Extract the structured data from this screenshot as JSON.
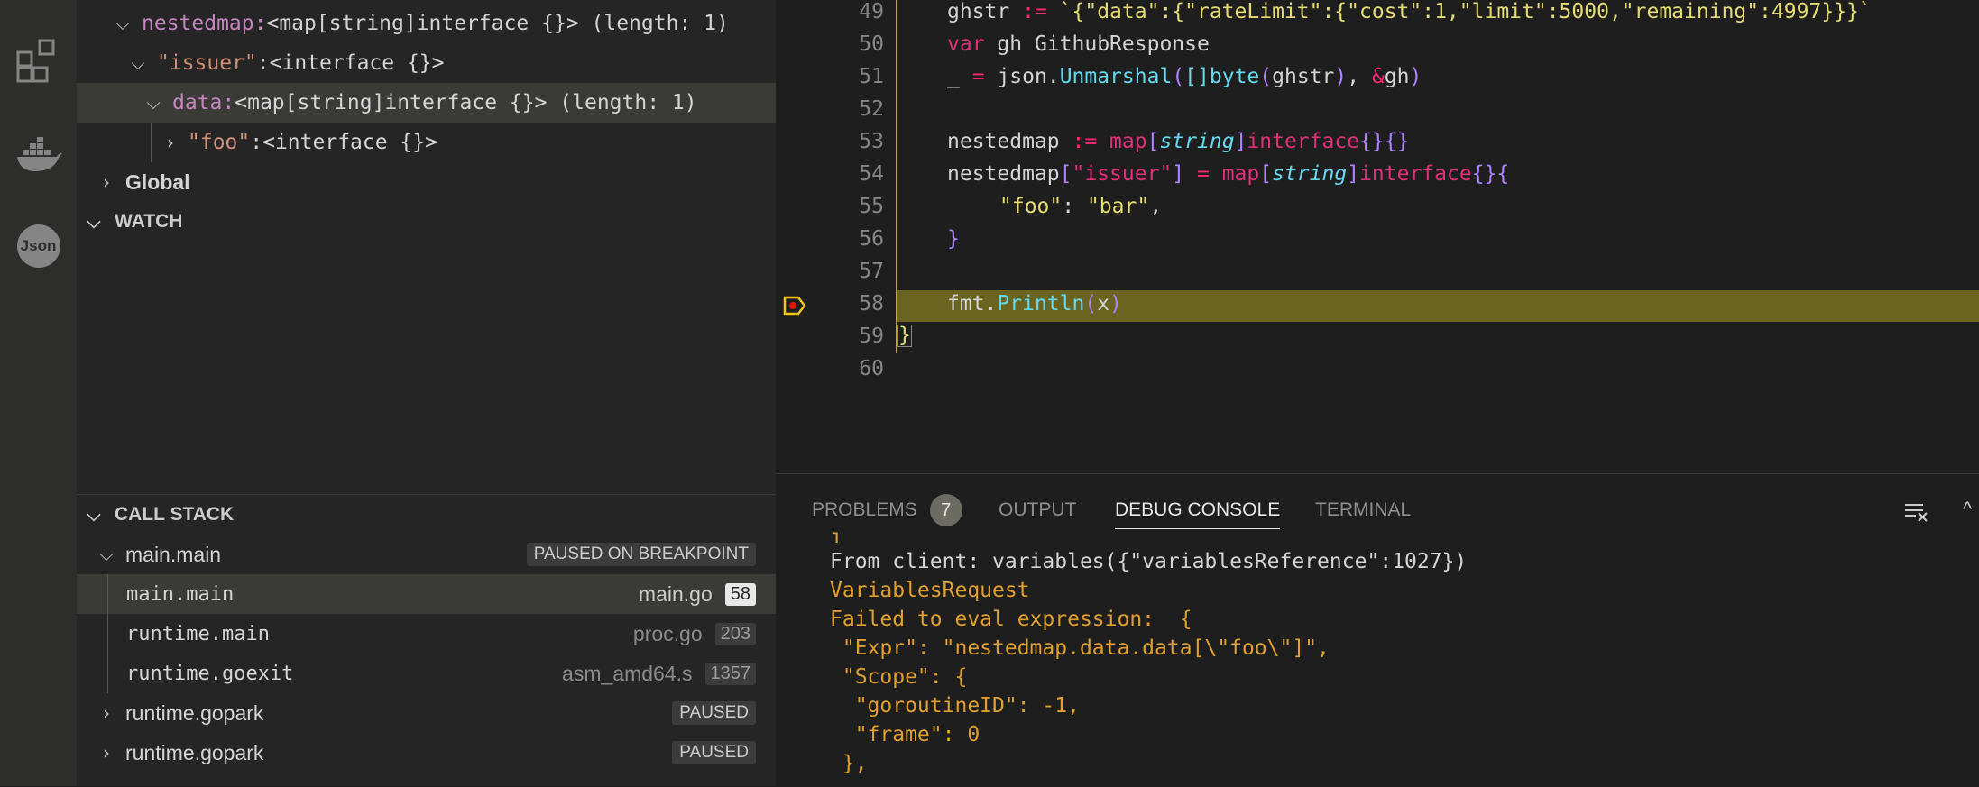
{
  "activity_bar": {
    "icons": [
      "extensions-icon",
      "docker-icon",
      "json-icon"
    ],
    "json_icon_label": "Json"
  },
  "variables": {
    "rows": [
      {
        "key": "nestedmap",
        "sep": ": ",
        "value": "<map[string]interface {}> (length: 1)"
      },
      {
        "key": "\"issuer\"",
        "sep": ": ",
        "value": "<interface {}>"
      },
      {
        "key": "data",
        "sep": ": ",
        "value": "<map[string]interface {}> (length: 1)"
      },
      {
        "key": "\"foo\"",
        "sep": ": ",
        "value": "<interface {}>"
      }
    ],
    "global_label": "Global"
  },
  "watch": {
    "header": "WATCH"
  },
  "call_stack": {
    "header": "CALL STACK",
    "thread_main": {
      "label": "main.main",
      "status": "PAUSED ON BREAKPOINT"
    },
    "frames": [
      {
        "name": "main.main",
        "file": "main.go",
        "line": "58"
      },
      {
        "name": "runtime.main",
        "file": "proc.go",
        "line": "203"
      },
      {
        "name": "runtime.goexit",
        "file": "asm_amd64.s",
        "line": "1357"
      }
    ],
    "threads": [
      {
        "label": "runtime.gopark",
        "status": "PAUSED"
      },
      {
        "label": "runtime.gopark",
        "status": "PAUSED"
      }
    ]
  },
  "editor": {
    "line_numbers": [
      "49",
      "50",
      "51",
      "52",
      "53",
      "54",
      "55",
      "56",
      "57",
      "58",
      "59",
      "60"
    ],
    "line_49": {
      "var": "ghstr",
      "op": ":=",
      "str": "`{\"data\":{\"rateLimit\":{\"cost\":1,\"limit\":5000,\"remaining\":4997}}}`"
    },
    "line_50": {
      "kw": "var",
      "name": "gh",
      "type": "GithubResponse"
    },
    "line_51": {
      "blank": "_",
      "op": "=",
      "pkg": "json.",
      "fn": "Unmarshal",
      "p1": "(",
      "br": "[]",
      "ty": "byte",
      "p2": "(",
      "arg": "ghstr",
      "p3": ")",
      "comma": ", ",
      "amp": "&",
      "arg2": "gh",
      "p4": ")"
    },
    "line_53": {
      "var": "nestedmap",
      "op": ":=",
      "kw1": "map",
      "b1": "[",
      "ty": "string",
      "b2": "]",
      "kw2": "interface",
      "br": "{}",
      "br2": "{}"
    },
    "line_54": {
      "var": "nestedmap",
      "b1": "[",
      "key": "\"issuer\"",
      "b2": "]",
      "op": "=",
      "kw1": "map",
      "b3": "[",
      "ty": "string",
      "b4": "]",
      "kw2": "interface",
      "br": "{}",
      "br2": "{"
    },
    "line_55": {
      "key": "\"foo\"",
      "colon": ": ",
      "val": "\"bar\"",
      "comma": ","
    },
    "line_56": {
      "brace": "}"
    },
    "line_58": {
      "pkg": "fmt.",
      "fn": "Println",
      "p1": "(",
      "arg": "x",
      "p2": ")"
    },
    "line_59": {
      "brace": "}"
    }
  },
  "panel": {
    "tabs": [
      {
        "label": "PROBLEMS",
        "badge": "7"
      },
      {
        "label": "OUTPUT"
      },
      {
        "label": "DEBUG CONSOLE"
      },
      {
        "label": "TERMINAL"
      }
    ],
    "console_lines": [
      {
        "text": "]",
        "color": "#e0a030"
      },
      {
        "text": "From client: variables({\"variablesReference\":1027})",
        "color": "#d4d4d4"
      },
      {
        "text": "VariablesRequest",
        "color": "#e0a030"
      },
      {
        "text": "Failed to eval expression:  {",
        "color": "#e0a030"
      },
      {
        "text": " \"Expr\": \"nestedmap.data.data[\\\"foo\\\"]\",",
        "color": "#e0a030"
      },
      {
        "text": " \"Scope\": {",
        "color": "#e0a030"
      },
      {
        "text": "  \"goroutineID\": -1,",
        "color": "#e0a030"
      },
      {
        "text": "  \"frame\": 0",
        "color": "#e0a030"
      },
      {
        "text": " },",
        "color": "#e0a030"
      }
    ]
  }
}
